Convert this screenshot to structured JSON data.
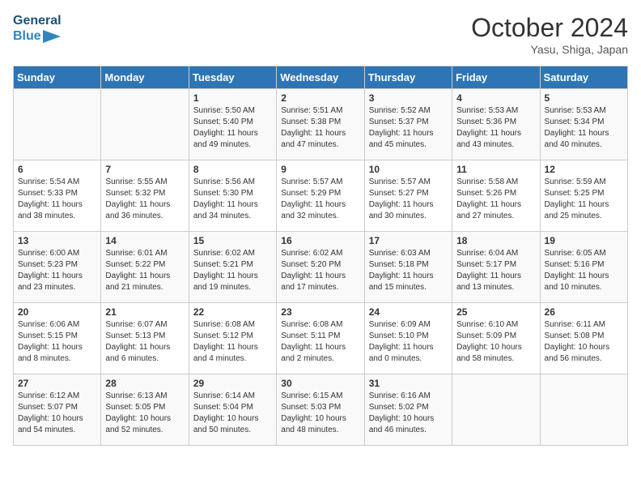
{
  "header": {
    "logo_line1": "General",
    "logo_line2": "Blue",
    "month": "October 2024",
    "location": "Yasu, Shiga, Japan"
  },
  "days_of_week": [
    "Sunday",
    "Monday",
    "Tuesday",
    "Wednesday",
    "Thursday",
    "Friday",
    "Saturday"
  ],
  "weeks": [
    [
      {
        "day": "",
        "info": ""
      },
      {
        "day": "",
        "info": ""
      },
      {
        "day": "1",
        "info": "Sunrise: 5:50 AM\nSunset: 5:40 PM\nDaylight: 11 hours and 49 minutes."
      },
      {
        "day": "2",
        "info": "Sunrise: 5:51 AM\nSunset: 5:38 PM\nDaylight: 11 hours and 47 minutes."
      },
      {
        "day": "3",
        "info": "Sunrise: 5:52 AM\nSunset: 5:37 PM\nDaylight: 11 hours and 45 minutes."
      },
      {
        "day": "4",
        "info": "Sunrise: 5:53 AM\nSunset: 5:36 PM\nDaylight: 11 hours and 43 minutes."
      },
      {
        "day": "5",
        "info": "Sunrise: 5:53 AM\nSunset: 5:34 PM\nDaylight: 11 hours and 40 minutes."
      }
    ],
    [
      {
        "day": "6",
        "info": "Sunrise: 5:54 AM\nSunset: 5:33 PM\nDaylight: 11 hours and 38 minutes."
      },
      {
        "day": "7",
        "info": "Sunrise: 5:55 AM\nSunset: 5:32 PM\nDaylight: 11 hours and 36 minutes."
      },
      {
        "day": "8",
        "info": "Sunrise: 5:56 AM\nSunset: 5:30 PM\nDaylight: 11 hours and 34 minutes."
      },
      {
        "day": "9",
        "info": "Sunrise: 5:57 AM\nSunset: 5:29 PM\nDaylight: 11 hours and 32 minutes."
      },
      {
        "day": "10",
        "info": "Sunrise: 5:57 AM\nSunset: 5:27 PM\nDaylight: 11 hours and 30 minutes."
      },
      {
        "day": "11",
        "info": "Sunrise: 5:58 AM\nSunset: 5:26 PM\nDaylight: 11 hours and 27 minutes."
      },
      {
        "day": "12",
        "info": "Sunrise: 5:59 AM\nSunset: 5:25 PM\nDaylight: 11 hours and 25 minutes."
      }
    ],
    [
      {
        "day": "13",
        "info": "Sunrise: 6:00 AM\nSunset: 5:23 PM\nDaylight: 11 hours and 23 minutes."
      },
      {
        "day": "14",
        "info": "Sunrise: 6:01 AM\nSunset: 5:22 PM\nDaylight: 11 hours and 21 minutes."
      },
      {
        "day": "15",
        "info": "Sunrise: 6:02 AM\nSunset: 5:21 PM\nDaylight: 11 hours and 19 minutes."
      },
      {
        "day": "16",
        "info": "Sunrise: 6:02 AM\nSunset: 5:20 PM\nDaylight: 11 hours and 17 minutes."
      },
      {
        "day": "17",
        "info": "Sunrise: 6:03 AM\nSunset: 5:18 PM\nDaylight: 11 hours and 15 minutes."
      },
      {
        "day": "18",
        "info": "Sunrise: 6:04 AM\nSunset: 5:17 PM\nDaylight: 11 hours and 13 minutes."
      },
      {
        "day": "19",
        "info": "Sunrise: 6:05 AM\nSunset: 5:16 PM\nDaylight: 11 hours and 10 minutes."
      }
    ],
    [
      {
        "day": "20",
        "info": "Sunrise: 6:06 AM\nSunset: 5:15 PM\nDaylight: 11 hours and 8 minutes."
      },
      {
        "day": "21",
        "info": "Sunrise: 6:07 AM\nSunset: 5:13 PM\nDaylight: 11 hours and 6 minutes."
      },
      {
        "day": "22",
        "info": "Sunrise: 6:08 AM\nSunset: 5:12 PM\nDaylight: 11 hours and 4 minutes."
      },
      {
        "day": "23",
        "info": "Sunrise: 6:08 AM\nSunset: 5:11 PM\nDaylight: 11 hours and 2 minutes."
      },
      {
        "day": "24",
        "info": "Sunrise: 6:09 AM\nSunset: 5:10 PM\nDaylight: 11 hours and 0 minutes."
      },
      {
        "day": "25",
        "info": "Sunrise: 6:10 AM\nSunset: 5:09 PM\nDaylight: 10 hours and 58 minutes."
      },
      {
        "day": "26",
        "info": "Sunrise: 6:11 AM\nSunset: 5:08 PM\nDaylight: 10 hours and 56 minutes."
      }
    ],
    [
      {
        "day": "27",
        "info": "Sunrise: 6:12 AM\nSunset: 5:07 PM\nDaylight: 10 hours and 54 minutes."
      },
      {
        "day": "28",
        "info": "Sunrise: 6:13 AM\nSunset: 5:05 PM\nDaylight: 10 hours and 52 minutes."
      },
      {
        "day": "29",
        "info": "Sunrise: 6:14 AM\nSunset: 5:04 PM\nDaylight: 10 hours and 50 minutes."
      },
      {
        "day": "30",
        "info": "Sunrise: 6:15 AM\nSunset: 5:03 PM\nDaylight: 10 hours and 48 minutes."
      },
      {
        "day": "31",
        "info": "Sunrise: 6:16 AM\nSunset: 5:02 PM\nDaylight: 10 hours and 46 minutes."
      },
      {
        "day": "",
        "info": ""
      },
      {
        "day": "",
        "info": ""
      }
    ]
  ]
}
